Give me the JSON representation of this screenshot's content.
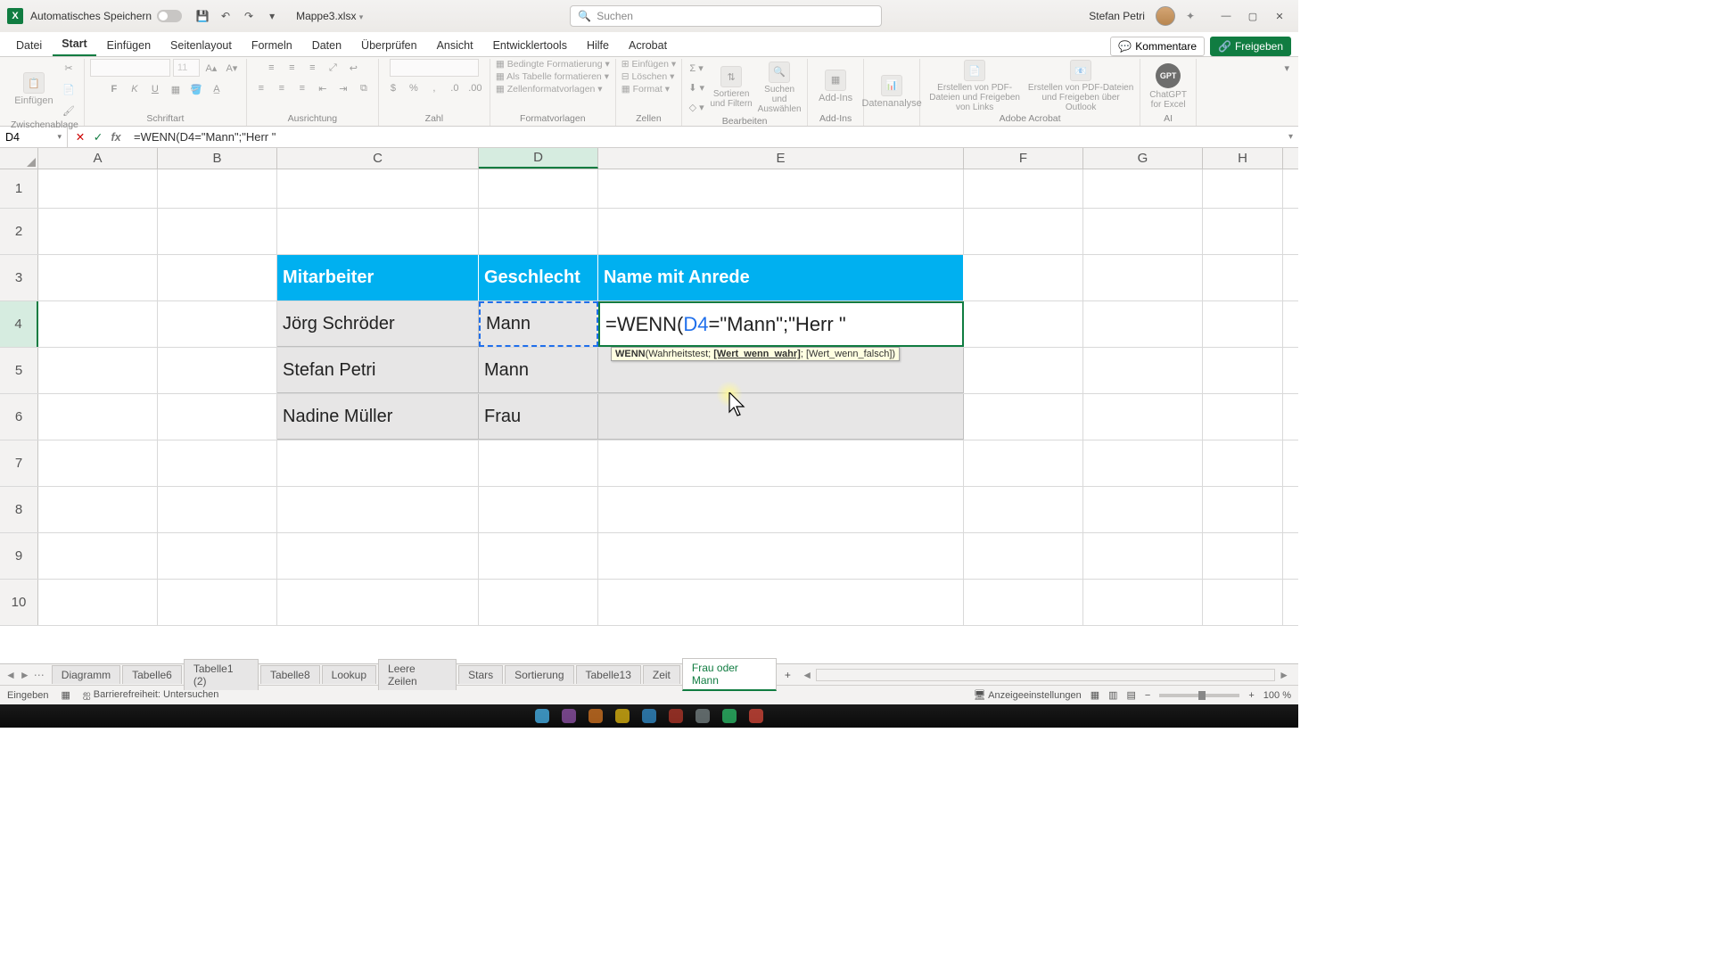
{
  "titlebar": {
    "excel_glyph": "X",
    "autosave_label": "Automatisches Speichern",
    "filename": "Mappe3.xlsx",
    "search_placeholder": "Suchen",
    "user_name": "Stefan Petri"
  },
  "tabs": {
    "items": [
      "Datei",
      "Start",
      "Einfügen",
      "Seitenlayout",
      "Formeln",
      "Daten",
      "Überprüfen",
      "Ansicht",
      "Entwicklertools",
      "Hilfe",
      "Acrobat"
    ],
    "active_index": 1,
    "comments": "Kommentare",
    "share": "Freigeben"
  },
  "ribbon": {
    "groups": {
      "clipboard": {
        "paste": "Einfügen",
        "label": "Zwischenablage"
      },
      "font": {
        "name": "",
        "size": "11",
        "label": "Schriftart"
      },
      "alignment": {
        "label": "Ausrichtung"
      },
      "number": {
        "combo": "",
        "label": "Zahl"
      },
      "styles": {
        "cond": "Bedingte Formatierung",
        "table": "Als Tabelle formatieren",
        "cellstyles": "Zellenformatvorlagen",
        "label": "Formatvorlagen"
      },
      "cells": {
        "insert": "Einfügen",
        "delete": "Löschen",
        "format": "Format",
        "label": "Zellen"
      },
      "editing": {
        "sortfilter": "Sortieren und Filtern",
        "findselect": "Suchen und Auswählen",
        "label": "Bearbeiten"
      },
      "addins": {
        "addins": "Add-Ins",
        "label": "Add-Ins"
      },
      "data_analysis": {
        "btn": "Datenanalyse"
      },
      "acrobat": {
        "pdf_links": "Erstellen von PDF-Dateien und Freigeben von Links",
        "pdf_outlook": "Erstellen von PDF-Dateien und Freigeben über Outlook",
        "label": "Adobe Acrobat"
      },
      "ai": {
        "gpt": "GPT",
        "gpt_label": "ChatGPT for Excel",
        "label": "AI"
      }
    }
  },
  "formula_bar": {
    "namebox": "D4",
    "formula_text": "=WENN(D4=\"Mann\";\"Herr \""
  },
  "columns": [
    "A",
    "B",
    "C",
    "D",
    "E",
    "F",
    "G",
    "H"
  ],
  "row_numbers": [
    "1",
    "2",
    "3",
    "4",
    "5",
    "6",
    "7",
    "8",
    "9",
    "10"
  ],
  "table": {
    "headers": {
      "c": "Mitarbeiter",
      "d": "Geschlecht",
      "e": "Name mit Anrede"
    },
    "rows": [
      {
        "c": "Jörg Schröder",
        "d": "Mann",
        "e_formula": {
          "pre": "=WENN(",
          "ref": "D4",
          "post": "=\"Mann\";\"Herr \""
        }
      },
      {
        "c": "Stefan Petri",
        "d": "Mann"
      },
      {
        "c": "Nadine Müller",
        "d": "Frau"
      }
    ]
  },
  "tooltip": {
    "fn": "WENN",
    "arg1": "Wahrheitstest",
    "arg2": "[Wert_wenn_wahr]",
    "arg3": "[Wert_wenn_falsch]"
  },
  "sheets": {
    "items": [
      "Diagramm",
      "Tabelle6",
      "Tabelle1 (2)",
      "Tabelle8",
      "Lookup",
      "Leere Zeilen",
      "Stars",
      "Sortierung",
      "Tabelle13",
      "Zeit",
      "Frau oder Mann"
    ],
    "active_index": 10
  },
  "statusbar": {
    "mode": "Eingeben",
    "accessibility": "Barrierefreiheit: Untersuchen",
    "display_settings": "Anzeigeeinstellungen",
    "zoom": "100 %"
  }
}
